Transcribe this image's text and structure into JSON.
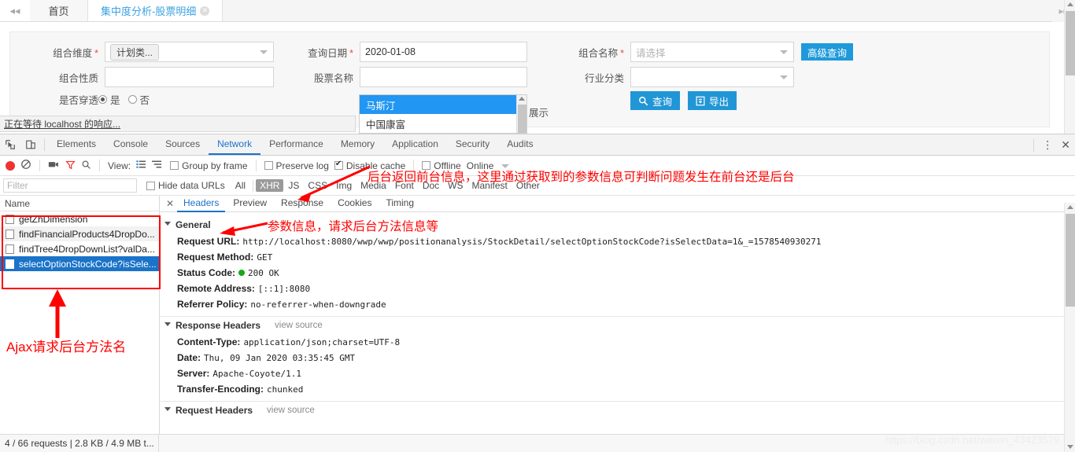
{
  "app": {
    "tabs": [
      {
        "label": "首页",
        "active": false,
        "closable": false
      },
      {
        "label": "集中度分析-股票明细",
        "active": true,
        "closable": true
      }
    ],
    "collapse_icon": "double-chevron-left-icon",
    "expand_icon": "double-chevron-right-icon",
    "form": {
      "dimension_label": "组合维度",
      "dimension_value": "计划类...",
      "nature_label": "组合性质",
      "nature_value": "",
      "penetrate_label": "是否穿透",
      "penetrate_yes": "是",
      "penetrate_no": "否",
      "date_label": "查询日期",
      "date_value": "2020-01-08",
      "stock_label": "股票名称",
      "stock_value": "",
      "portfolio_label": "组合名称",
      "portfolio_placeholder": "请选择",
      "industry_label": "行业分类",
      "industry_value": "",
      "advanced_button": "高级查询",
      "search_button": "查询",
      "export_button": "导出",
      "partial_text": "展示",
      "dropdown_options": [
        "马斯汀",
        "中国康富"
      ]
    },
    "status_bubble": "正在等待 localhost 的响应..."
  },
  "devtools": {
    "panels": [
      "Elements",
      "Console",
      "Sources",
      "Network",
      "Performance",
      "Memory",
      "Application",
      "Security",
      "Audits"
    ],
    "active_panel": "Network",
    "inspect_icon": "inspect-element-icon",
    "device_icon": "device-toolbar-icon",
    "more_icon": "kebab-menu-icon",
    "close_icon": "close-icon",
    "toolbar": {
      "record_icon": "record-stop-icon",
      "clear_icon": "clear-icon",
      "capture_screenshots_icon": "camera-icon",
      "filter_icon": "filter-funnel-icon",
      "search_icon": "search-icon",
      "view_label": "View:",
      "list_view_icon": "list-view-icon",
      "waterfall_view_icon": "waterfall-view-icon",
      "group_by_frame": "Group by frame",
      "group_by_frame_checked": false,
      "preserve_log": "Preserve log",
      "preserve_log_checked": false,
      "disable_cache": "Disable cache",
      "disable_cache_checked": true,
      "offline": "Offline",
      "offline_checked": false,
      "throttling": "Online"
    },
    "filterbar": {
      "filter_placeholder": "Filter",
      "filter_value": "",
      "hide_data_urls": "Hide data URLs",
      "hide_data_urls_checked": false,
      "types": [
        "All",
        "XHR",
        "JS",
        "CSS",
        "Img",
        "Media",
        "Font",
        "Doc",
        "WS",
        "Manifest",
        "Other"
      ],
      "active_type": "XHR"
    },
    "request_list": {
      "column": "Name",
      "rows": [
        {
          "name": "getZhDimension",
          "selected": false
        },
        {
          "name": "findFinancialProducts4DropDo...",
          "selected": false
        },
        {
          "name": "findTree4DropDownList?valDa...",
          "selected": false
        },
        {
          "name": "selectOptionStockCode?isSele...",
          "selected": true
        }
      ]
    },
    "detail": {
      "tabs": [
        "Headers",
        "Preview",
        "Response",
        "Cookies",
        "Timing"
      ],
      "active_tab": "Headers",
      "general": {
        "title": "General",
        "rows": [
          {
            "key": "Request URL:",
            "value": "http://localhost:8080/wwp/wwp/positionanalysis/StockDetail/selectOptionStockCode?isSelectData=1&_=1578540930271"
          },
          {
            "key": "Request Method:",
            "value": "GET"
          },
          {
            "key": "Status Code:",
            "value": "200 OK",
            "status_dot": "#17a81a"
          },
          {
            "key": "Remote Address:",
            "value": "[::1]:8080"
          },
          {
            "key": "Referrer Policy:",
            "value": "no-referrer-when-downgrade"
          }
        ]
      },
      "response_headers": {
        "title": "Response Headers",
        "view_source": "view source",
        "rows": [
          {
            "key": "Content-Type:",
            "value": "application/json;charset=UTF-8"
          },
          {
            "key": "Date:",
            "value": "Thu, 09 Jan 2020 03:35:45 GMT"
          },
          {
            "key": "Server:",
            "value": "Apache-Coyote/1.1"
          },
          {
            "key": "Transfer-Encoding:",
            "value": "chunked"
          }
        ]
      },
      "request_headers": {
        "title": "Request Headers",
        "view_source": "view source"
      }
    },
    "status_text": "4 / 66 requests | 2.8 KB / 4.9 MB t..."
  },
  "annotations": {
    "top_note": "后台返回前台信息，这里通过获取到的参数信息可判断问题发生在前台还是后台",
    "general_note": "参数信息，请求后台方法信息等",
    "list_note": "Ajax请求后台方法名",
    "color": "#ff0000"
  },
  "watermark": "https://blog.csdn.net/weixin_43423579"
}
